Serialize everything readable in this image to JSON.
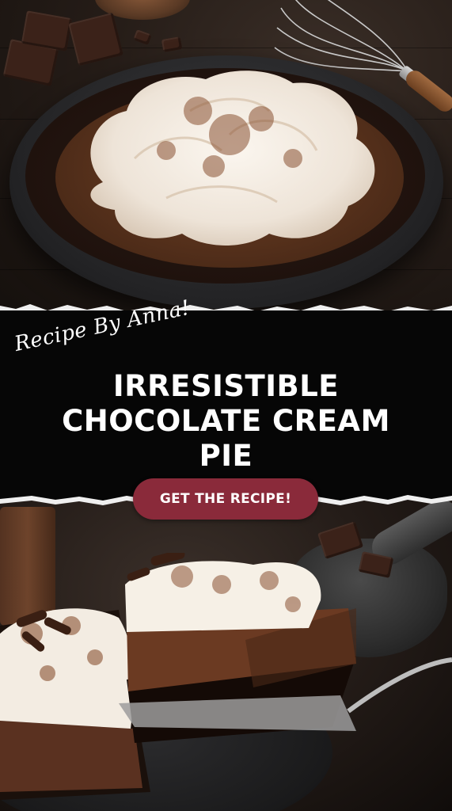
{
  "pin": {
    "script_text": "Recipe By Anna!",
    "title_lines": [
      "IRRESISTIBLE",
      "CHOCOLATE CREAM",
      "PIE"
    ],
    "cta_label": "GET THE RECIPE!"
  },
  "colors": {
    "band_background": "#060606",
    "cta_background": "#8a2a3a",
    "text": "#ffffff"
  },
  "images": {
    "top": "whole-chocolate-cream-pie-photo",
    "bottom": "pie-slice-being-served-photo"
  }
}
